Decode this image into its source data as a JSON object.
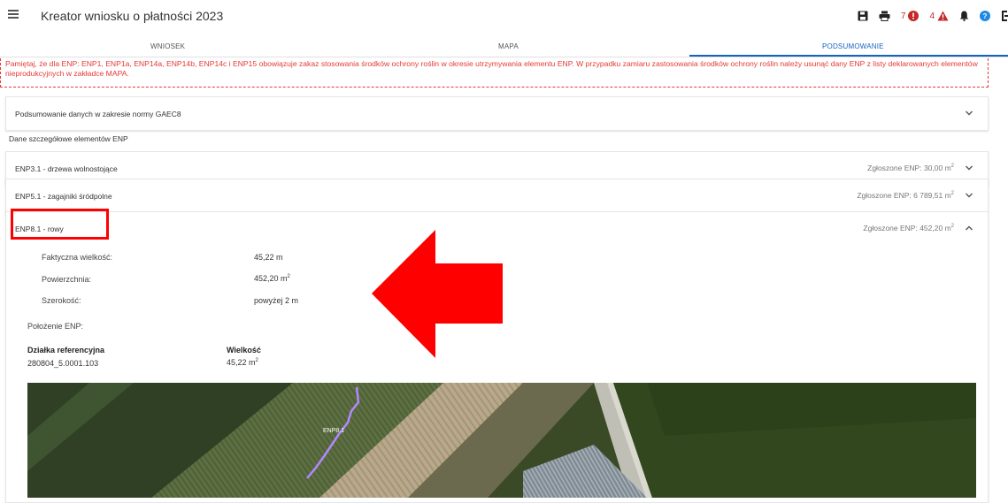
{
  "appbar": {
    "title": "Kreator wniosku o płatności 2023",
    "errors_count": "7",
    "warnings_count": "4",
    "icons": [
      "menu-icon",
      "save-icon",
      "print-icon",
      "error-icon",
      "warning-icon",
      "bell-icon",
      "help-icon",
      "logout-icon"
    ]
  },
  "tabs": [
    {
      "label": "WNIOSEK",
      "active": false
    },
    {
      "label": "MAPA",
      "active": false
    },
    {
      "label": "PODSUMOWANIE",
      "active": true
    }
  ],
  "warning": {
    "text": "Pamiętaj, że dla ENP: ENP1, ENP1a, ENP14a, ENP14b, ENP14c i ENP15 obowiązuje zakaz stosowania środków ochrony roślin w okresie utrzymywania elementu ENP. W przypadku zamiaru zastosowania środków ochrony roślin należy usunąć dany ENP z listy deklarowanych elementów nieprodukcyjnych w zakładce MAPA."
  },
  "summary_panel": {
    "title": "Podsumowanie danych w zakresie normy GAEC8"
  },
  "section_label": "Dane szczegółowe elementów ENP",
  "enp_panels": [
    {
      "title": "ENP3.1 - drzewa wolnostojące",
      "declared_label": "Zgłoszone ENP:",
      "declared_value": "30,00 m",
      "unit_sup": "2"
    },
    {
      "title": "ENP5.1 - zagajniki śródpolne",
      "declared_label": "Zgłoszone ENP:",
      "declared_value": "6 789,51 m",
      "unit_sup": "2"
    },
    {
      "title": "ENP8.1 - rowy",
      "declared_label": "Zgłoszone ENP:",
      "declared_value": "452,20 m",
      "unit_sup": "2"
    }
  ],
  "detail": {
    "rows": [
      {
        "label": "Faktyczna wielkość:",
        "value": "45,22 m",
        "sup": ""
      },
      {
        "label": "Powierzchnia:",
        "value": "452,20 m",
        "sup": "2"
      },
      {
        "label": "Szerokość:",
        "value": "powyżej 2 m",
        "sup": ""
      }
    ],
    "location_label": "Położenie ENP:",
    "columns": [
      "Działka referencyjna",
      "Wielkość"
    ],
    "parcel": {
      "id": "280804_5.0001.103",
      "size": "45,22 m",
      "sup": "2"
    },
    "map_label": "ENP8.1"
  },
  "colors": {
    "accent": "#1565c0",
    "error": "#e53935",
    "highlight": "#ff0000"
  }
}
